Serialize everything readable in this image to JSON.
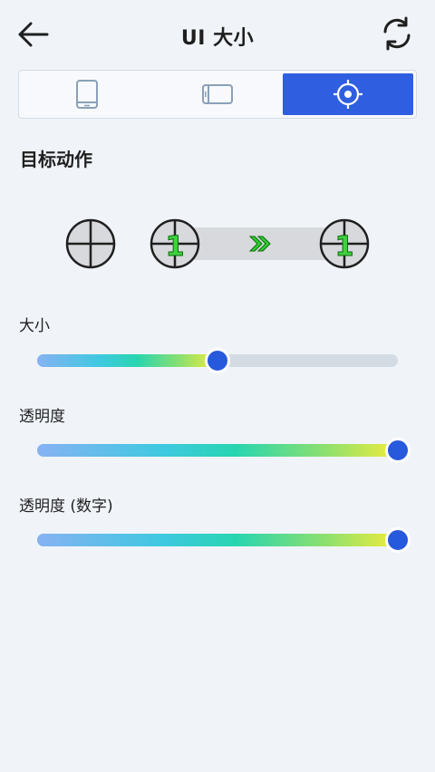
{
  "header": {
    "title": "UI 大小",
    "back_icon": "arrow-left-icon",
    "refresh_icon": "refresh-icon"
  },
  "tabs": [
    {
      "icon": "phone-portrait-icon",
      "active": false
    },
    {
      "icon": "phone-landscape-icon",
      "active": false
    },
    {
      "icon": "crosshair-target-icon",
      "active": true
    }
  ],
  "section": {
    "title": "目标动作"
  },
  "preview": {
    "left_number": "1",
    "right_number": "1",
    "arrow_icon": "double-chevron-right-icon"
  },
  "sliders": [
    {
      "label": "大小",
      "value": 0.5
    },
    {
      "label": "透明度",
      "value": 1.0
    },
    {
      "label": "透明度 (数字)",
      "value": 1.0
    }
  ],
  "colors": {
    "accent": "#2f5fe0",
    "thumb": "#2759dc",
    "track": "#d4dbe3",
    "background": "#f0f4f9",
    "arrow_green": "#2ecc2e"
  }
}
